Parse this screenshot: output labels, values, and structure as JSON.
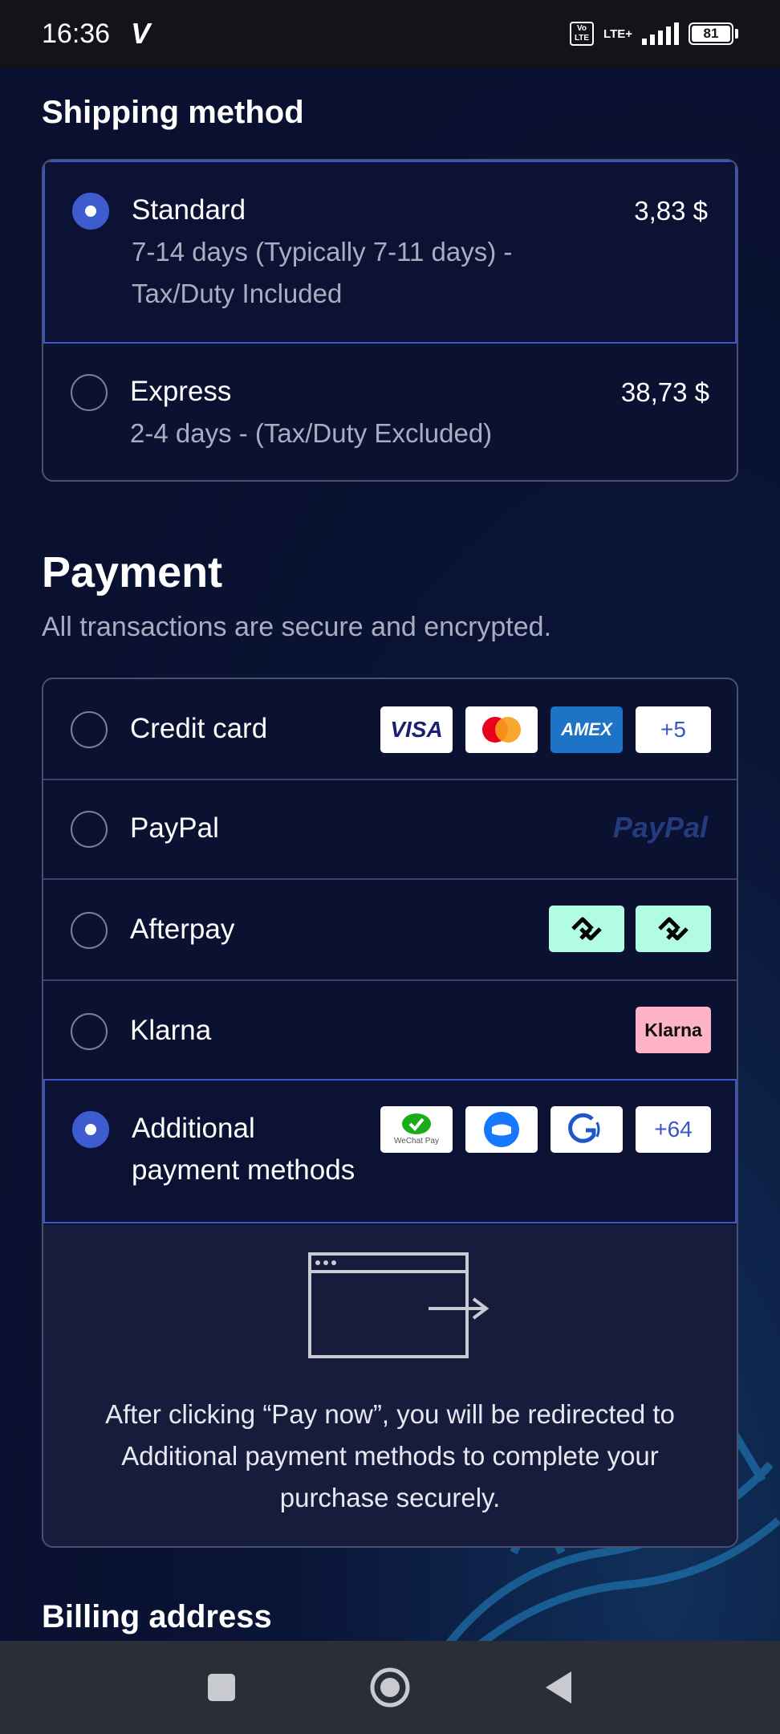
{
  "status_bar": {
    "time": "16:36",
    "carrier_glyph": "V",
    "volte": "Vo LTE",
    "network": "LTE+",
    "battery": "81"
  },
  "shipping": {
    "title": "Shipping method",
    "options": [
      {
        "name": "Standard",
        "desc_line1": "7-14 days (Typically 7-11 days) -",
        "desc_line2": "Tax/Duty Included",
        "price": "3,83 $",
        "selected": true
      },
      {
        "name": "Express",
        "desc_line1": "2-4 days - (Tax/Duty Excluded)",
        "price": "38,73 $",
        "selected": false
      }
    ]
  },
  "payment": {
    "title": "Payment",
    "subtitle": "All transactions are secure and encrypted.",
    "options": [
      {
        "name": "Credit card",
        "selected": false,
        "more": "+5"
      },
      {
        "name": "PayPal",
        "selected": false
      },
      {
        "name": "Afterpay",
        "selected": false
      },
      {
        "name": "Klarna",
        "selected": false
      },
      {
        "name_line1": "Additional",
        "name_line2": "payment methods",
        "selected": true,
        "more": "+64"
      }
    ],
    "logos": {
      "visa": "VISA",
      "amex": "AMEX",
      "paypal": "PayPal",
      "klarna": "Klarna",
      "wechat": "WeChat Pay"
    },
    "redirect_line1": "After clicking “Pay now”, you will be redirected to",
    "redirect_line2": "Additional payment methods to complete your",
    "redirect_line3": "purchase securely."
  },
  "billing": {
    "title": "Billing address"
  },
  "colors": {
    "accent": "#3f5bd0",
    "background": "#0a1030",
    "paypal_blue": "#253b80",
    "paypal_light": "#179bd7"
  }
}
